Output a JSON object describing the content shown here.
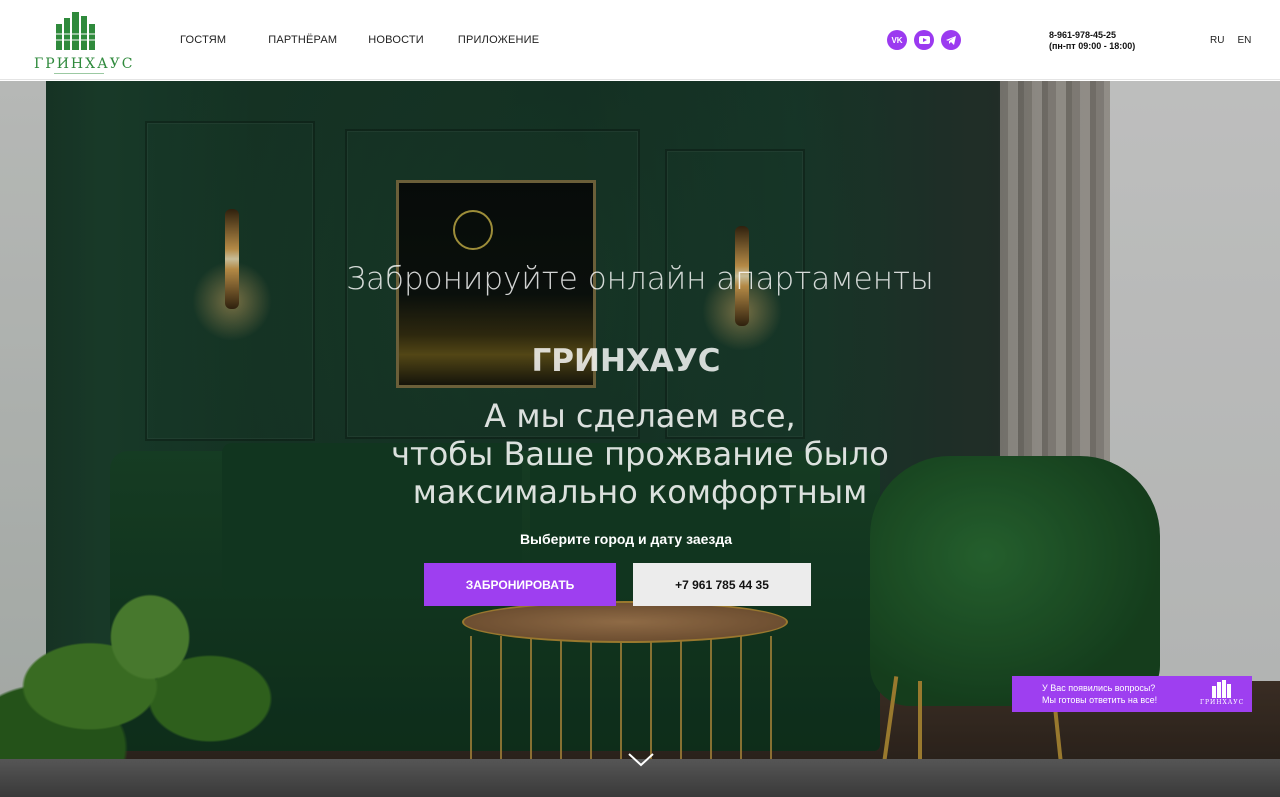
{
  "header": {
    "logo_text": "ГРИНХАУС",
    "nav": [
      {
        "label": "ГОСТЯМ"
      },
      {
        "label": "ПАРТНЁРАМ"
      },
      {
        "label": "НОВОСТИ"
      },
      {
        "label": "ПРИЛОЖЕНИЕ"
      }
    ],
    "socials": [
      {
        "icon": "vk-icon",
        "label": "VK"
      },
      {
        "icon": "youtube-icon"
      },
      {
        "icon": "telegram-icon"
      }
    ],
    "phone": "8-961-978-45-25",
    "hours": "(пн-пт 09:00 - 18:00)",
    "languages": [
      "RU",
      "EN"
    ]
  },
  "hero": {
    "line1": "Забронируйте онлайн  апартаменты",
    "brand": "ГРИНХАУС",
    "tagline": [
      "А мы сделаем все,",
      "чтобы Ваше прожвание было",
      "максимально комфортным"
    ],
    "prompt": "Выберите город и дату заезда",
    "book_button": "ЗАБРОНИРОВАТЬ",
    "phone_button": "+7 961 785 44 35"
  },
  "chat_widget": {
    "line1": "У Вас появились вопросы?",
    "line2": "Мы готовы ответить на все!",
    "logo_text": "ГРИНХАУС"
  },
  "colors": {
    "accent": "#9e3ff0",
    "brand_green": "#2f8a3c"
  }
}
